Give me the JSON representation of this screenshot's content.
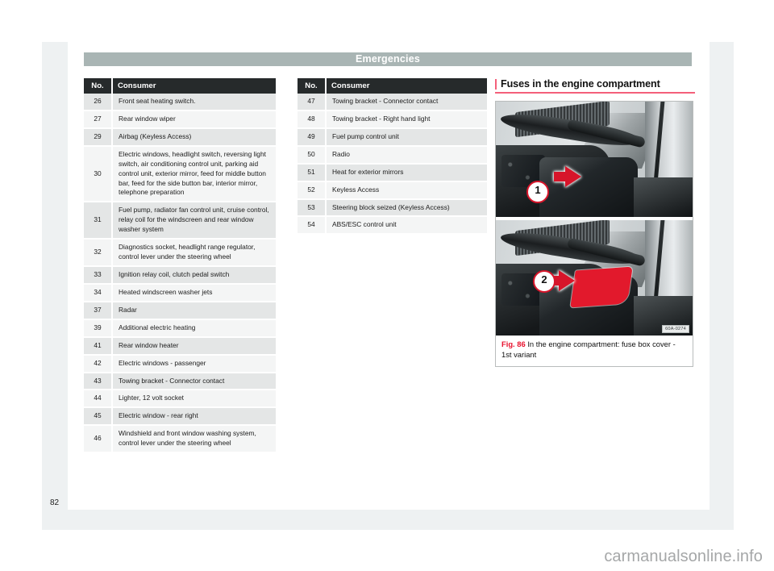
{
  "header": {
    "title": "Emergencies"
  },
  "page_number": "82",
  "watermark": "carmanualsonline.info",
  "tables": {
    "columns": {
      "no": "No.",
      "consumer": "Consumer"
    },
    "left": [
      {
        "no": "26",
        "consumer": "Front seat heating switch."
      },
      {
        "no": "27",
        "consumer": "Rear window wiper"
      },
      {
        "no": "29",
        "consumer": "Airbag (Keyless Access)"
      },
      {
        "no": "30",
        "consumer": "Electric windows, headlight switch, reversing light switch, air conditioning control unit, parking aid control unit, exterior mirror, feed for middle button bar, feed for the side button bar, interior mirror, telephone preparation"
      },
      {
        "no": "31",
        "consumer": "Fuel pump, radiator fan control unit, cruise control, relay coil for the windscreen and rear window washer system"
      },
      {
        "no": "32",
        "consumer": "Diagnostics socket, headlight range regulator, control lever under the steering wheel"
      },
      {
        "no": "33",
        "consumer": "Ignition relay coil, clutch pedal switch"
      },
      {
        "no": "34",
        "consumer": "Heated windscreen washer jets"
      },
      {
        "no": "37",
        "consumer": "Radar"
      },
      {
        "no": "39",
        "consumer": "Additional electric heating"
      },
      {
        "no": "41",
        "consumer": "Rear window heater"
      },
      {
        "no": "42",
        "consumer": "Electric windows - passenger"
      },
      {
        "no": "43",
        "consumer": "Towing bracket - Connector contact"
      },
      {
        "no": "44",
        "consumer": "Lighter, 12 volt socket"
      },
      {
        "no": "45",
        "consumer": "Electric window - rear right"
      },
      {
        "no": "46",
        "consumer": "Windshield and front window washing system, control lever under the steering wheel"
      }
    ],
    "middle": [
      {
        "no": "47",
        "consumer": "Towing bracket - Connector contact"
      },
      {
        "no": "48",
        "consumer": "Towing bracket - Right hand light"
      },
      {
        "no": "49",
        "consumer": "Fuel pump control unit"
      },
      {
        "no": "50",
        "consumer": "Radio"
      },
      {
        "no": "51",
        "consumer": "Heat for exterior mirrors"
      },
      {
        "no": "52",
        "consumer": "Keyless Access"
      },
      {
        "no": "53",
        "consumer": "Steering block seized (Keyless Access)"
      },
      {
        "no": "54",
        "consumer": "ABS/ESC control unit"
      }
    ]
  },
  "section": {
    "heading": "Fuses in the engine compartment",
    "figure": {
      "label": "Fig. 86",
      "caption": "In the engine compartment: fuse box cover - 1st variant",
      "photo_code": "60A-0274",
      "callout_1": "1",
      "callout_2": "2"
    }
  },
  "colors": {
    "accent_red": "#f4607a",
    "figure_label_red": "#e8112d",
    "header_bar": "#a9b5b4",
    "table_header": "#262a2b",
    "row_odd": "#e4e6e6",
    "row_even": "#f4f5f5",
    "mat": "#eef1f2"
  }
}
